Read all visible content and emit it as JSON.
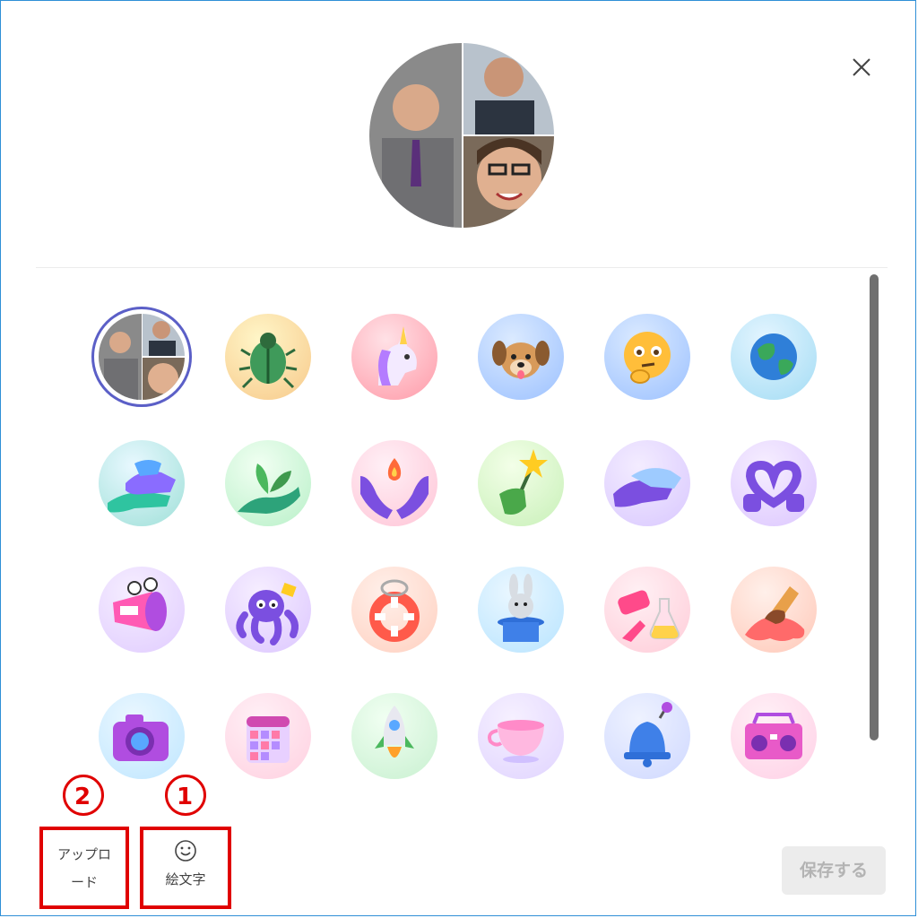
{
  "dialog": {
    "close_icon": "close-icon",
    "save_label": "保存する"
  },
  "toolbar": {
    "upload_label_line1": "アップロ",
    "upload_label_line2": "ード",
    "emoji_label": "絵文字",
    "emoji_icon": "smiley-icon"
  },
  "annotations": {
    "marker_1": "1",
    "marker_2": "2",
    "color": "#e00000"
  },
  "avatars": [
    {
      "name": "group-photo",
      "selected": true
    },
    {
      "name": "beetle"
    },
    {
      "name": "unicorn"
    },
    {
      "name": "dog"
    },
    {
      "name": "thinking-face"
    },
    {
      "name": "globe"
    },
    {
      "name": "hands-stacked"
    },
    {
      "name": "hand-with-plant"
    },
    {
      "name": "hands-with-flame"
    },
    {
      "name": "hand-with-wand"
    },
    {
      "name": "handshake"
    },
    {
      "name": "heart-hands"
    },
    {
      "name": "megaphone-monster"
    },
    {
      "name": "octopus"
    },
    {
      "name": "life-ring"
    },
    {
      "name": "rabbit-in-hat"
    },
    {
      "name": "science-lab"
    },
    {
      "name": "melting-ice-cream"
    },
    {
      "name": "camera"
    },
    {
      "name": "calendar"
    },
    {
      "name": "rocket"
    },
    {
      "name": "teacup"
    },
    {
      "name": "bell"
    },
    {
      "name": "boombox"
    }
  ],
  "colors": {
    "accent": "#5b5fc7",
    "border": "#2f8fd6"
  }
}
